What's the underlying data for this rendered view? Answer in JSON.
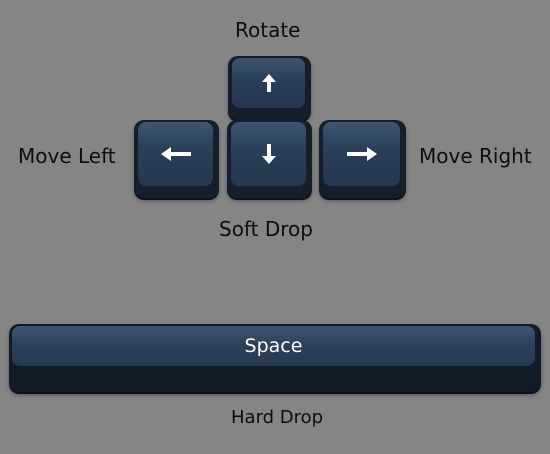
{
  "controls": {
    "rotate_label": "Rotate",
    "move_left_label": "Move Left",
    "move_right_label": "Move Right",
    "soft_drop_label": "Soft Drop",
    "hard_drop_label": "Hard Drop"
  },
  "keys": {
    "up_icon": "arrow-up-icon",
    "down_icon": "arrow-down-icon",
    "left_icon": "arrow-left-icon",
    "right_icon": "arrow-right-icon",
    "space_label": "Space"
  },
  "colors": {
    "background": "#858585",
    "key_cap": "#2c425b",
    "key_base": "#151f2c",
    "label_text": "#0d0d0d",
    "key_text": "#ffffff"
  }
}
